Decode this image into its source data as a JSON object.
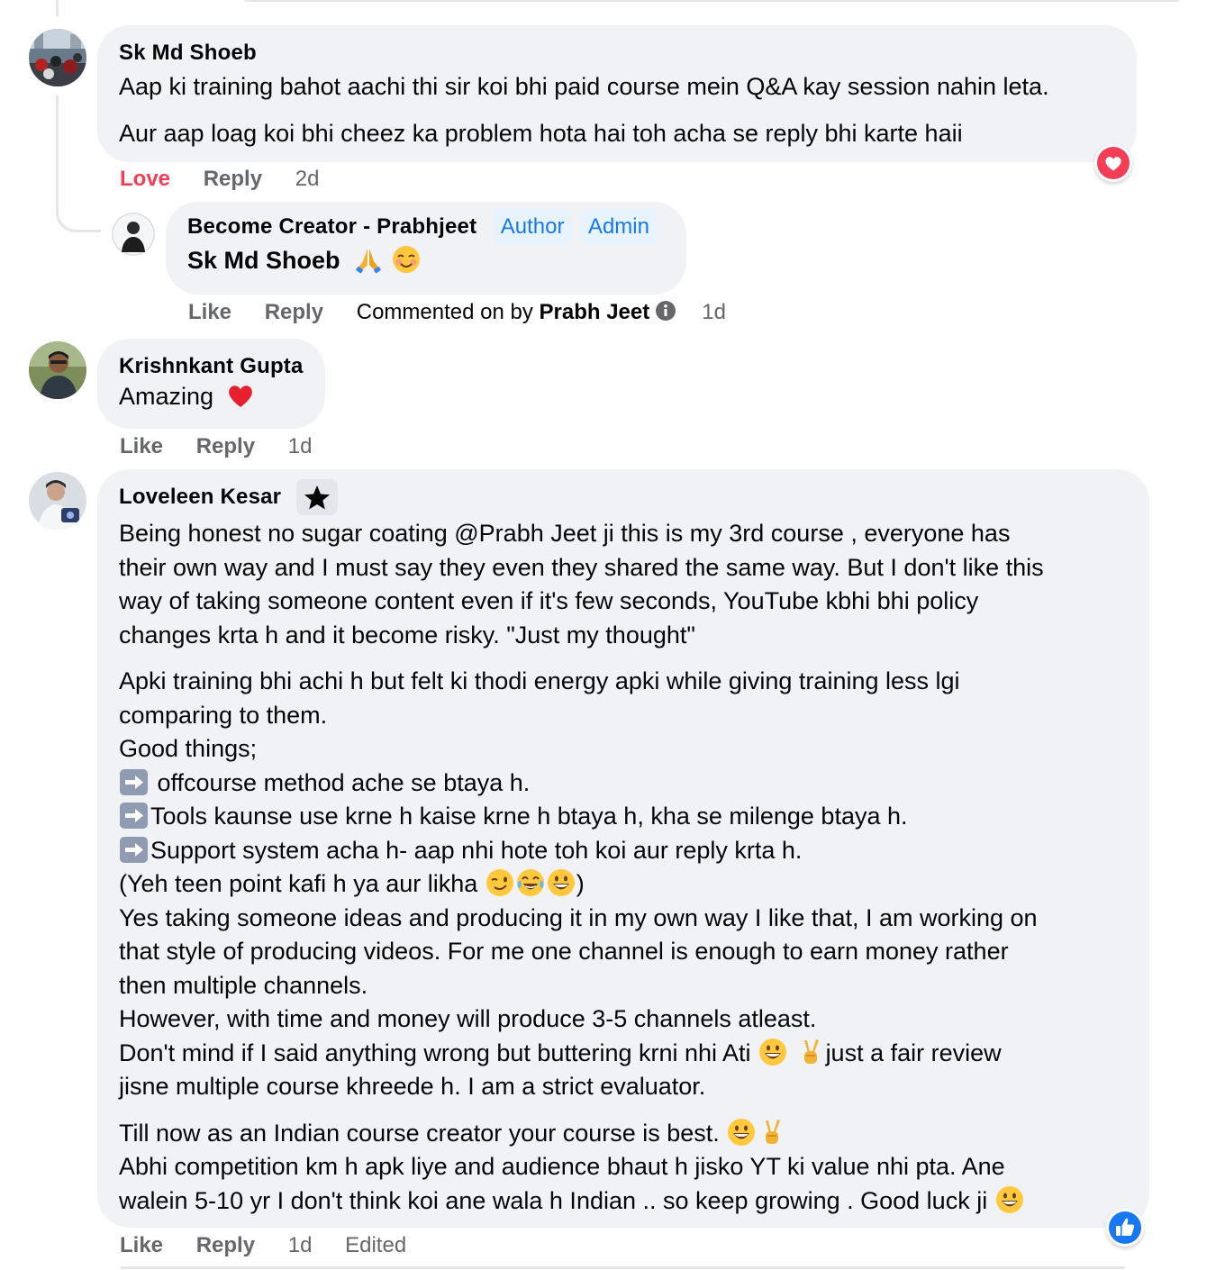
{
  "comments": [
    {
      "author": "Sk Md Shoeb",
      "paragraphs": [
        [
          "Aap ki training bahot aachi thi sir koi bhi paid course mein Q&A kay session nahin leta."
        ],
        [
          "Aur aap loag koi bhi cheez ka problem hota hai toh acha se reply bhi karte haii"
        ]
      ],
      "reaction_label": "Love",
      "reply_label": "Reply",
      "time": "2d",
      "reaction_icon": "heart-reaction-icon",
      "reply": {
        "author": "Become Creator - Prabhjeet",
        "badges": [
          "Author",
          "Admin"
        ],
        "mention": "Sk Md Shoeb",
        "emojis": [
          "folded-hands-emoji",
          "smiling-blush-emoji"
        ],
        "like_label": "Like",
        "reply_label": "Reply",
        "commented_on_prefix": "Commented on by",
        "commented_on_name": "Prabh Jeet",
        "time": "1d"
      }
    },
    {
      "author": "Krishnkant Gupta",
      "text": "Amazing",
      "emoji": "red-heart-emoji",
      "like_label": "Like",
      "reply_label": "Reply",
      "time": "1d"
    },
    {
      "author": "Loveleen Kesar",
      "badge_icon": "star-icon",
      "p1": [
        "Being honest no sugar coating @Prabh Jeet ji this is my 3rd course , everyone has",
        "their own way and I must say they even they shared the same way. But I don't like this",
        "way of taking someone content even if it's few seconds, YouTube kbhi bhi policy",
        "changes krta h and it become risky. \"Just my thought\""
      ],
      "p2a": [
        "Apki training bhi achi h but felt ki thodi energy apki while giving training less lgi",
        "comparing to them.",
        "Good things;"
      ],
      "bullets": [
        " offcourse method ache se btaya h.",
        "Tools kaunse use krne h kaise krne h btaya h, kha se milenge btaya h.",
        "Support system acha h- aap nhi hote toh koi aur reply krta h."
      ],
      "p2_emoji_line_start": "(Yeh teen point kafi h ya aur likha ",
      "p2_emoji_line_end": ")",
      "p2b": [
        "Yes taking someone ideas and producing it in my own way I like that, I am working on",
        "that style of producing videos. For me one channel is enough to earn money rather",
        "then multiple channels.",
        "However, with time and money will produce 3-5 channels atleast."
      ],
      "p2_line_mind_start": "Don't mind if I said anything wrong but buttering krni nhi Ati ",
      "p2_line_mind_end": "just a fair review",
      "p2_last": "jisne multiple course khreede h. I am a strict evaluator.",
      "p3_line1": "Till now as an Indian course creator your course is best. ",
      "p3_line2": "Abhi competition km h apk liye and audience bhaut h jisko YT ki value nhi pta. Ane",
      "p3_line3": "walein 5-10 yr I don't think koi ane wala h Indian .. so keep growing . Good luck ji ",
      "like_label": "Like",
      "reply_label": "Reply",
      "time": "1d",
      "edited_label": "Edited",
      "reaction_icon": "like-reaction-icon"
    }
  ],
  "colors": {
    "bubble": "#f0f2f5",
    "meta": "#65676b",
    "love": "#f33e58",
    "badge_text": "#1877f2",
    "badge_bg": "#e7f3ff",
    "like_blue": "#1877f2"
  }
}
